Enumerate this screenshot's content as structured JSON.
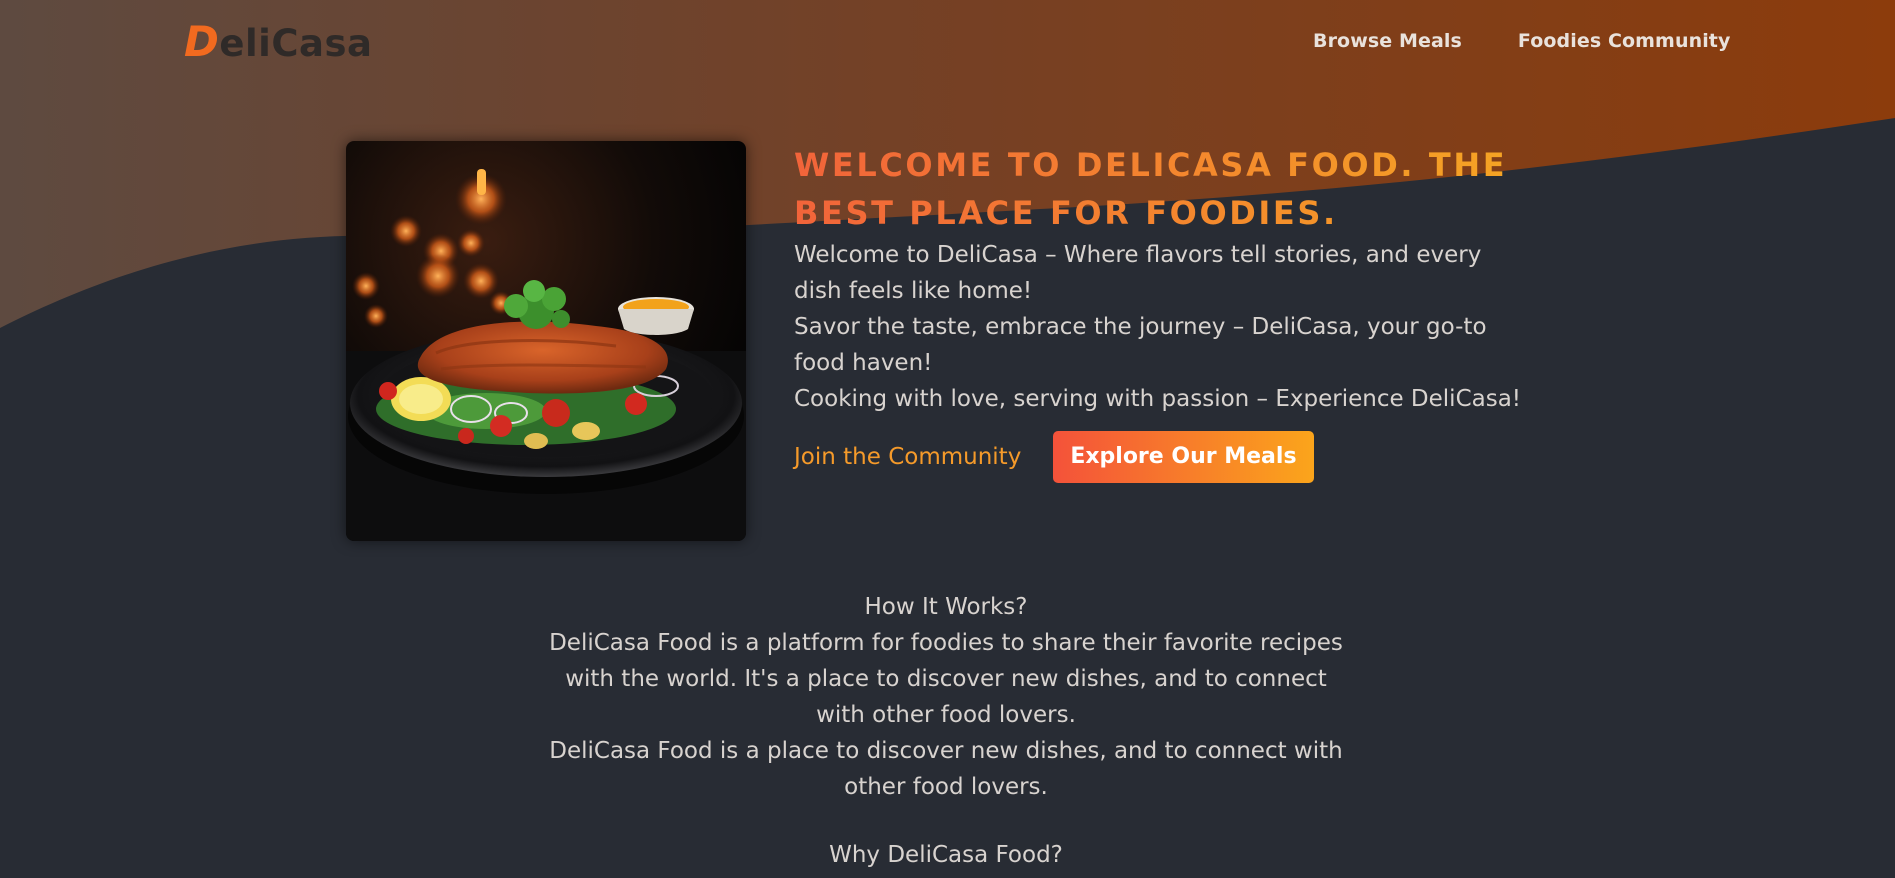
{
  "header": {
    "logo_initial": "D",
    "logo_rest": "eliCasa",
    "nav": [
      {
        "label": "Browse Meals"
      },
      {
        "label": "Foodies Community"
      }
    ]
  },
  "hero": {
    "title": "Welcome to DeliCasa Food. The best place for foodies.",
    "lines": [
      "Welcome to DeliCasa – Where flavors tell stories, and every dish feels like home!",
      "Savor the taste, embrace the journey – DeliCasa, your go-to food haven!",
      "Cooking with love, serving with passion – Experience DeliCasa!"
    ],
    "community_link": "Join the Community",
    "explore_button": "Explore Our Meals"
  },
  "how_it_works": {
    "heading": "How It Works?",
    "paragraphs": [
      "DeliCasa Food is a platform for foodies to share their favorite recipes with the world. It's a place to discover new dishes, and to connect with other food lovers.",
      "DeliCasa Food is a place to discover new dishes, and to connect with other food lovers."
    ]
  },
  "why": {
    "heading": "Why DeliCasa Food?"
  },
  "colors": {
    "page_background": "#282c34",
    "accent_start": "#f4523a",
    "accent_end": "#fba51b",
    "header_gradient_left": "#5c4a3f",
    "header_gradient_right": "#8a3d0e",
    "text": "#d8d3cf"
  }
}
